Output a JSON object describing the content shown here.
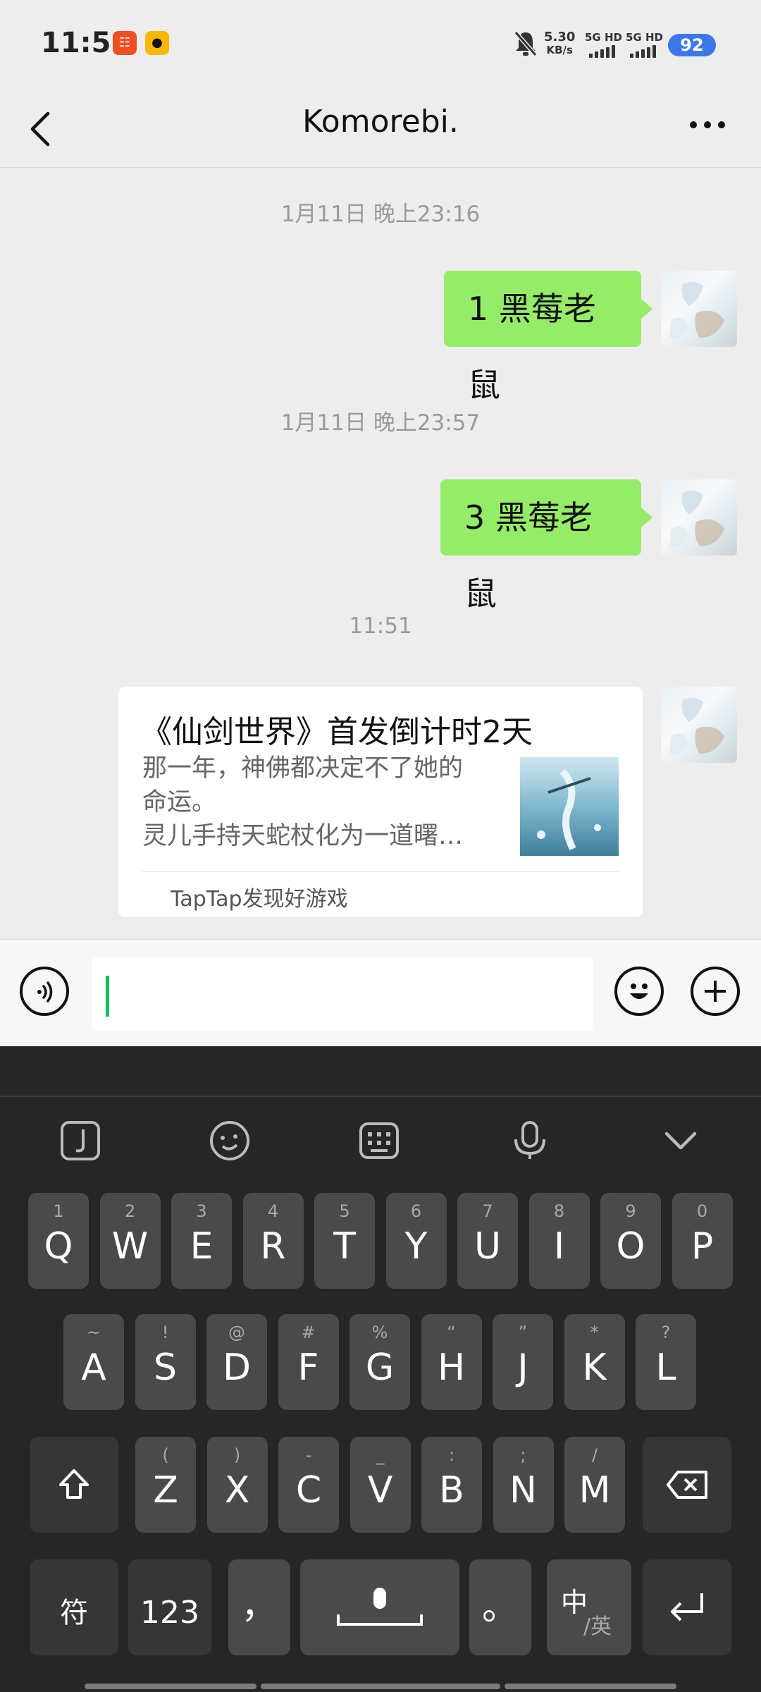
{
  "status_bar": {
    "time": "11:51",
    "net_speed": "5.30",
    "net_unit": "KB/s",
    "signal1": "5G HD",
    "signal2": "5G HD",
    "battery": "92"
  },
  "header": {
    "title": "Komorebi.",
    "back_icon": "chevron-left-icon",
    "more_icon": "more-dots-icon"
  },
  "chat": {
    "timestamps": [
      "1月11日 晚上23:16",
      "1月11日 晚上23:57",
      "11:51"
    ],
    "messages": [
      {
        "type": "text",
        "text": "1 黑莓老鼠",
        "from": "me"
      },
      {
        "type": "text",
        "text": "3 黑莓老鼠",
        "from": "me"
      }
    ],
    "card": {
      "title": "《仙剑世界》首发倒计时2天",
      "desc_line1": "那一年，神佛都决定不了她的",
      "desc_line2": "命运。",
      "desc_line3": "灵儿手持天蛇杖化为一道曙…",
      "source": "TapTap发现好游戏"
    }
  },
  "input_bar": {
    "voice_icon": "voice-icon",
    "emoji_icon": "emoji-icon",
    "plus_icon": "plus-icon",
    "accent": "#07c160"
  },
  "keyboard": {
    "toolbar": [
      "clipboard-icon",
      "emoji-face-icon",
      "keyboard-icon",
      "microphone-icon",
      "chevron-down-icon"
    ],
    "row1": [
      {
        "k": "Q",
        "s": "1"
      },
      {
        "k": "W",
        "s": "2"
      },
      {
        "k": "E",
        "s": "3"
      },
      {
        "k": "R",
        "s": "4"
      },
      {
        "k": "T",
        "s": "5"
      },
      {
        "k": "Y",
        "s": "6"
      },
      {
        "k": "U",
        "s": "7"
      },
      {
        "k": "I",
        "s": "8"
      },
      {
        "k": "O",
        "s": "9"
      },
      {
        "k": "P",
        "s": "0"
      }
    ],
    "row2": [
      {
        "k": "A",
        "s": "~"
      },
      {
        "k": "S",
        "s": "!"
      },
      {
        "k": "D",
        "s": "@"
      },
      {
        "k": "F",
        "s": "#"
      },
      {
        "k": "G",
        "s": "%"
      },
      {
        "k": "H",
        "s": "“"
      },
      {
        "k": "J",
        "s": "”"
      },
      {
        "k": "K",
        "s": "*"
      },
      {
        "k": "L",
        "s": "?"
      }
    ],
    "row3": [
      {
        "k": "Z",
        "s": "("
      },
      {
        "k": "X",
        "s": ")"
      },
      {
        "k": "C",
        "s": "-"
      },
      {
        "k": "V",
        "s": "_"
      },
      {
        "k": "B",
        "s": ":"
      },
      {
        "k": "N",
        "s": ";"
      },
      {
        "k": "M",
        "s": "/"
      }
    ],
    "bottom": {
      "symbols": "符",
      "numbers": "123",
      "comma": "，",
      "period": "。",
      "lang_main": "中",
      "lang_sub": "/英"
    }
  }
}
